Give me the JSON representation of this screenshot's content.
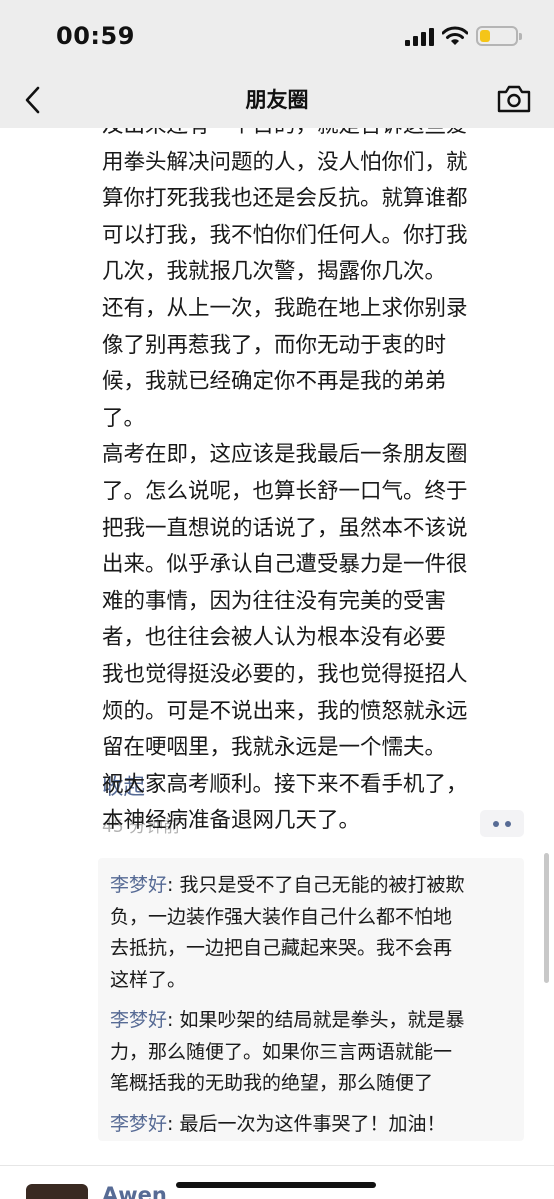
{
  "status_bar": {
    "time": "00:59",
    "battery_level": 0.3,
    "battery_color": "#f5c518"
  },
  "nav": {
    "title": "朋友圈",
    "back_icon": "chevron-left-icon",
    "camera_icon": "camera-icon"
  },
  "post": {
    "lines": [
      "及出来还有一个目的，就是告诉这些爱",
      "用拳头解决问题的人，没人怕你们，就",
      "算你打死我我也还是会反抗。就算谁都",
      "可以打我，我不怕你们任何人。你打我",
      "几次，我就报几次警，揭露你几次。",
      "还有，从上一次，我跪在地上求你别录",
      "像了别再惹我了，而你无动于衷的时",
      "候，我就已经确定你不再是我的弟弟",
      "了。",
      "高考在即，这应该是我最后一条朋友圈",
      "了。怎么说呢，也算长舒一口气。终于",
      "把我一直想说的话说了，虽然本不该说",
      "出来。似乎承认自己遭受暴力是一件很",
      "难的事情，因为往往没有完美的受害",
      "者，也往往会被人认为根本没有必要",
      "我也觉得挺没必要的，我也觉得挺招人",
      "烦的。可是不说出来，我的愤怒就永远",
      "留在哽咽里，我就永远是一个懦夫。",
      "祝大家高考顺利。接下来不看手机了，",
      "本神经病准备退网几天了。"
    ],
    "collapse_label": "收起",
    "timestamp": "45 分钟前"
  },
  "comments": [
    {
      "author": "李梦好",
      "lines": [
        ": 我只是受不了自己无能的被打被欺",
        "负，一边装作强大装作自己什么都不怕地",
        "去抵抗，一边把自己藏起来哭。我不会再",
        "这样了。"
      ]
    },
    {
      "author": "李梦好",
      "lines": [
        ": 如果吵架的结局就是拳头，就是暴",
        "力，那么随便了。如果你三言两语就能一",
        "笔概括我的无助我的绝望，那么随便了"
      ]
    },
    {
      "author": "李梦好",
      "lines": [
        ": 最后一次为这件事哭了！加油！"
      ]
    }
  ],
  "next_post": {
    "name": "Awen"
  },
  "colors": {
    "link": "#576b95",
    "chrome_bg": "#ededed",
    "comment_bg": "#f7f7f7"
  }
}
